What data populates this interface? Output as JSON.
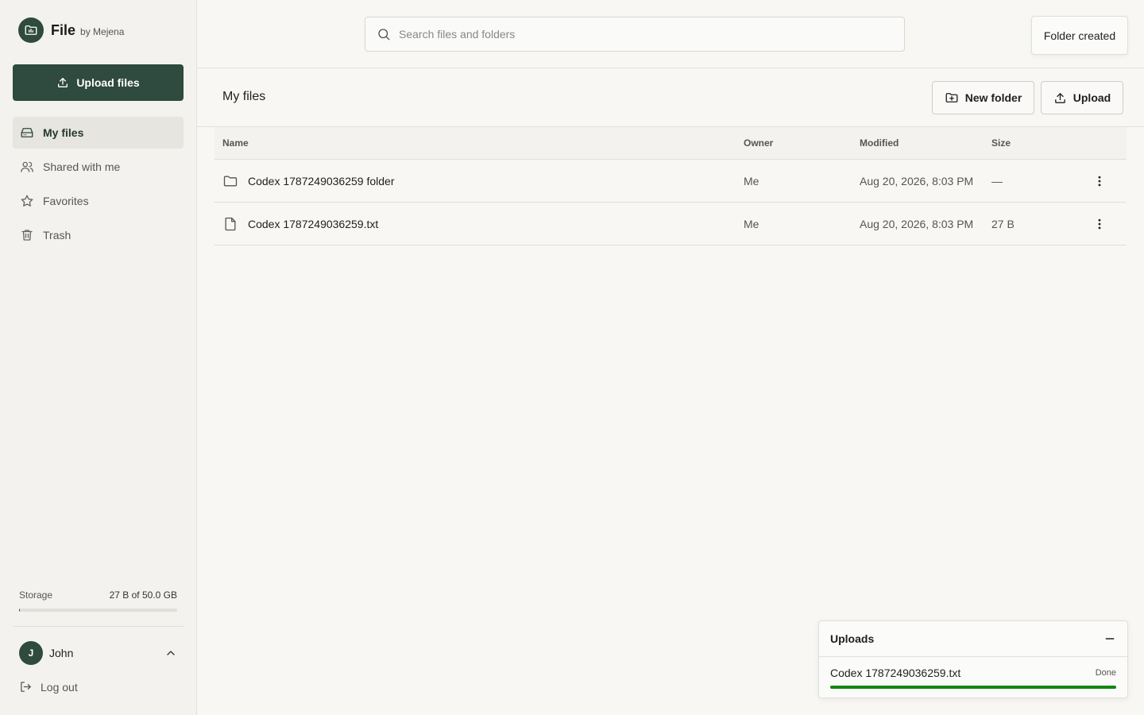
{
  "brand": {
    "name": "File",
    "by": "by Mejena"
  },
  "sidebar": {
    "upload_label": "Upload files",
    "items": [
      {
        "label": "My files",
        "icon": "drive-icon",
        "active": true
      },
      {
        "label": "Shared with me",
        "icon": "users-icon",
        "active": false
      },
      {
        "label": "Favorites",
        "icon": "star-icon",
        "active": false
      },
      {
        "label": "Trash",
        "icon": "trash-icon",
        "active": false
      }
    ],
    "storage": {
      "label": "Storage",
      "value": "27 B of 50.0 GB",
      "used_fraction": 1e-09
    },
    "user": {
      "initial": "J",
      "name": "John"
    },
    "logout_label": "Log out"
  },
  "search": {
    "placeholder": "Search files and folders",
    "value": ""
  },
  "toast": {
    "message": "Folder created"
  },
  "page": {
    "title": "My files",
    "new_folder_label": "New folder",
    "upload_label": "Upload"
  },
  "table": {
    "columns": [
      "Name",
      "Owner",
      "Modified",
      "Size"
    ],
    "rows": [
      {
        "type": "folder",
        "name": "Codex 1787249036259 folder",
        "owner": "Me",
        "modified": "Aug 20, 2026, 8:03 PM",
        "size": "—"
      },
      {
        "type": "file",
        "name": "Codex 1787249036259.txt",
        "owner": "Me",
        "modified": "Aug 20, 2026, 8:03 PM",
        "size": "27 B"
      }
    ]
  },
  "uploads": {
    "title": "Uploads",
    "items": [
      {
        "file": "Codex 1787249036259.txt",
        "status": "Done",
        "progress": 1.0
      }
    ]
  },
  "colors": {
    "accent": "#2f4a3e",
    "progress": "#12870f",
    "background": "#f8f7f4"
  }
}
